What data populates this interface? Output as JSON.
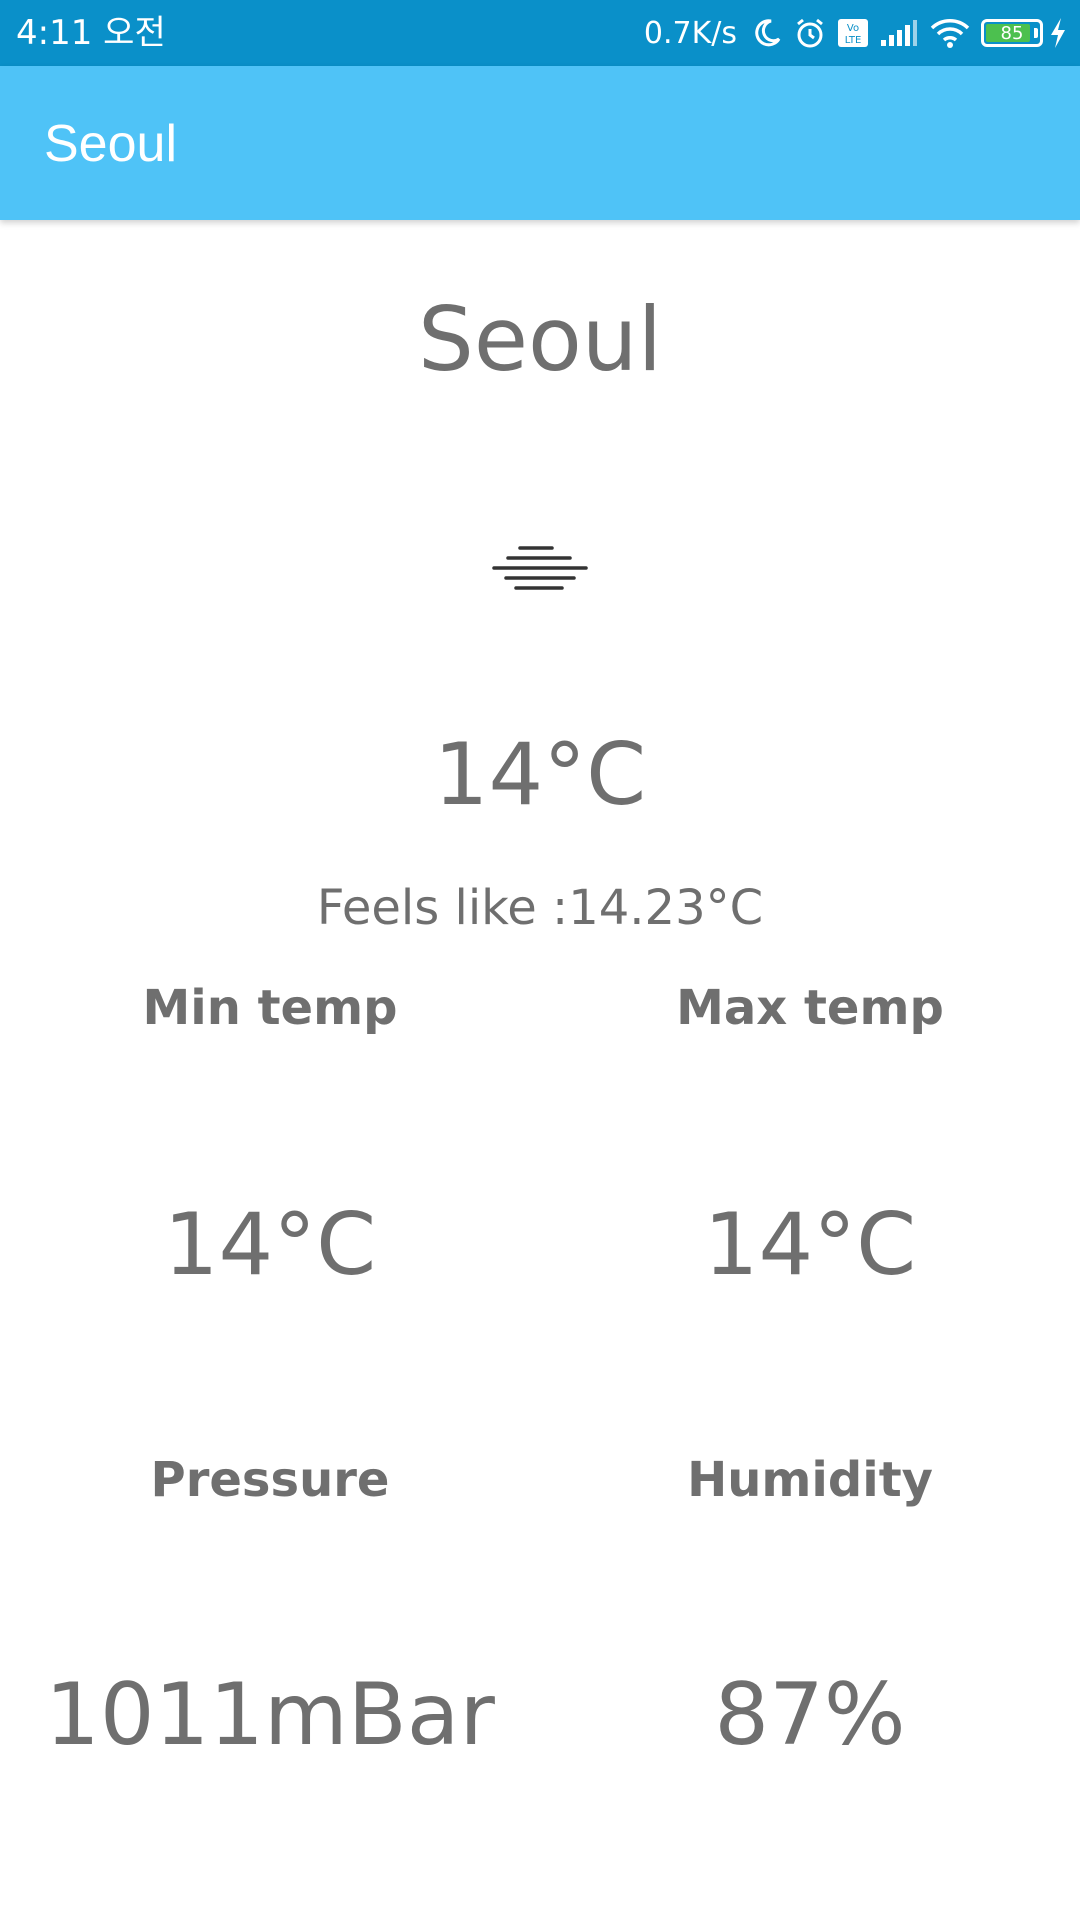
{
  "status_bar": {
    "time": "4:11 오전",
    "net_speed": "0.7K/s",
    "battery_level": "85",
    "battery_fraction": 0.85,
    "icons": [
      "moon-icon",
      "alarm-icon",
      "volte-icon",
      "signal-icon",
      "wifi-icon",
      "battery-icon",
      "charging-icon"
    ],
    "color": "#0a90c9"
  },
  "app_bar": {
    "title": "Seoul",
    "color": "#4fc3f7"
  },
  "weather": {
    "city": "Seoul",
    "condition_icon": "mist-icon",
    "temperature": "14°C",
    "feels_like": "Feels like :14.23°C"
  },
  "stats": {
    "min_temp": {
      "label": "Min temp",
      "value": "14°C"
    },
    "max_temp": {
      "label": "Max temp",
      "value": "14°C"
    },
    "pressure": {
      "label": "Pressure",
      "value": "1011mBar"
    },
    "humidity": {
      "label": "Humidity",
      "value": "87%"
    }
  },
  "text_color": "#6f6f6f"
}
